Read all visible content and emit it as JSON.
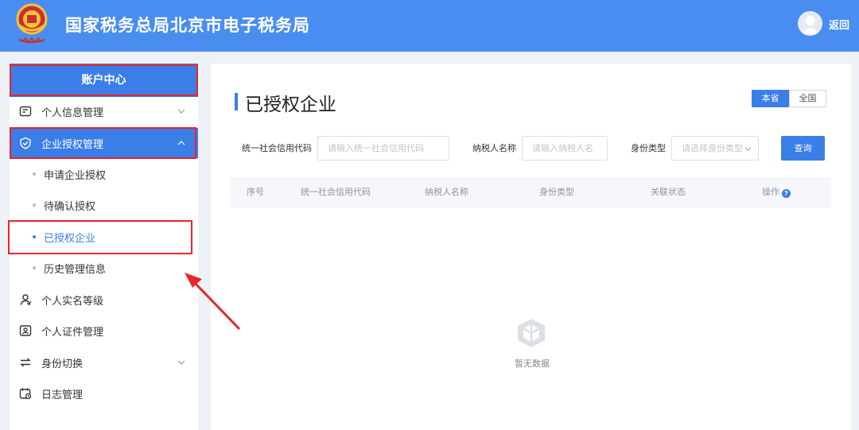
{
  "header": {
    "title": "国家税务总局北京市电子税务局",
    "back_label": "返回",
    "logo_icon": "tax-emblem-icon",
    "avatar_icon": "user-avatar-icon"
  },
  "sidebar": {
    "account_center": "账户中心",
    "items": [
      {
        "label": "个人信息管理",
        "icon": "profile-card-icon"
      },
      {
        "label": "企业授权管理",
        "icon": "shield-check-icon"
      },
      {
        "label": "申请企业授权"
      },
      {
        "label": "待确认授权"
      },
      {
        "label": "已授权企业"
      },
      {
        "label": "历史管理信息"
      },
      {
        "label": "个人实名等级",
        "icon": "user-level-icon"
      },
      {
        "label": "个人证件管理",
        "icon": "id-card-icon"
      },
      {
        "label": "身份切换",
        "icon": "switch-icon"
      },
      {
        "label": "日志管理",
        "icon": "calendar-log-icon"
      }
    ]
  },
  "main": {
    "title": "已授权企业",
    "scope": [
      "本省",
      "全国"
    ],
    "filters": {
      "credit_code_label": "统一社会信用代码",
      "credit_code_placeholder": "请输入统一社会信用代码",
      "taxpayer_label": "纳税人名称",
      "taxpayer_placeholder": "请输入纳税人名",
      "identity_label": "身份类型",
      "identity_placeholder": "请选择身份类型"
    },
    "query_button": "查询",
    "table_columns": [
      "序号",
      "统一社会信用代码",
      "纳税人名称",
      "身份类型",
      "关联状态",
      "操作"
    ],
    "help_glyph": "?",
    "empty_text": "暂无数据"
  },
  "colors": {
    "header_bg": "#4a8df0",
    "accent": "#3b7ee8",
    "highlight": "#e7262b"
  }
}
